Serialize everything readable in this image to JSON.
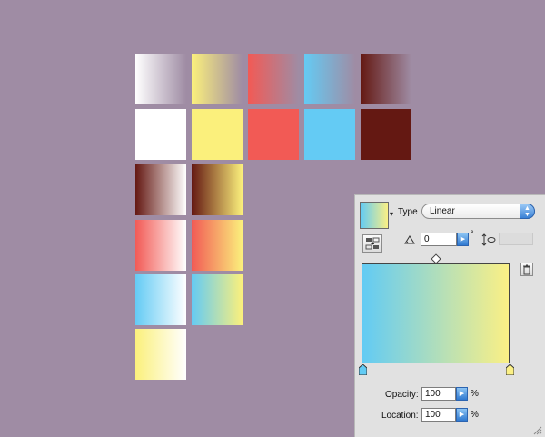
{
  "swatch_grid": {
    "row1_gradients": [
      {
        "name": "white-gradient-swatch",
        "from": "#ffffff",
        "to": "#9f8ca4"
      },
      {
        "name": "yellow-gradient-swatch",
        "from": "#fbf07c",
        "to": "#9f8ca4"
      },
      {
        "name": "red-gradient-swatch",
        "from": "#f25a55",
        "to": "#9f8ca4"
      },
      {
        "name": "blue-gradient-swatch",
        "from": "#64cbf4",
        "to": "#9f8ca4"
      },
      {
        "name": "brown-gradient-swatch",
        "from": "#641812",
        "to": "#9f8ca4"
      }
    ],
    "row2_solids": [
      {
        "name": "white-swatch",
        "color": "#ffffff"
      },
      {
        "name": "yellow-swatch",
        "color": "#fbf07c"
      },
      {
        "name": "red-swatch",
        "color": "#f25a55"
      },
      {
        "name": "blue-swatch",
        "color": "#64cbf4"
      },
      {
        "name": "brown-swatch",
        "color": "#641812"
      }
    ],
    "combo_gradients": [
      {
        "name": "brown-white-swatch",
        "from": "#641812",
        "to": "#ffffff"
      },
      {
        "name": "brown-yellow-swatch",
        "from": "#641812",
        "to": "#fbf07c"
      },
      {
        "name": "red-white-swatch",
        "from": "#f25a55",
        "to": "#ffffff"
      },
      {
        "name": "red-yellow-swatch",
        "from": "#f25a55",
        "to": "#fbf07c"
      },
      {
        "name": "blue-white-swatch",
        "from": "#64cbf4",
        "to": "#ffffff"
      },
      {
        "name": "blue-yellow-swatch",
        "from": "#64cbf4",
        "to": "#fbf07c"
      },
      {
        "name": "yellow-white-swatch",
        "from": "#fbf07c",
        "to": "#ffffff"
      }
    ]
  },
  "gradient_panel": {
    "type_label": "Type",
    "type_value": "Linear",
    "angle_value": "0",
    "degree_symbol": "°",
    "opacity_label": "Opacity:",
    "opacity_value": "100",
    "location_label": "Location:",
    "location_value": "100",
    "percent": "%",
    "gradient_from": "#62cbf4",
    "gradient_to": "#fbf085",
    "icons": [
      "gradient-preview",
      "dropdown-arrow",
      "reverse-gradient-icon",
      "angle-icon",
      "aspect-ratio-icon",
      "delete-stop-icon",
      "color-stop-icon",
      "resize-grip-icon"
    ]
  }
}
